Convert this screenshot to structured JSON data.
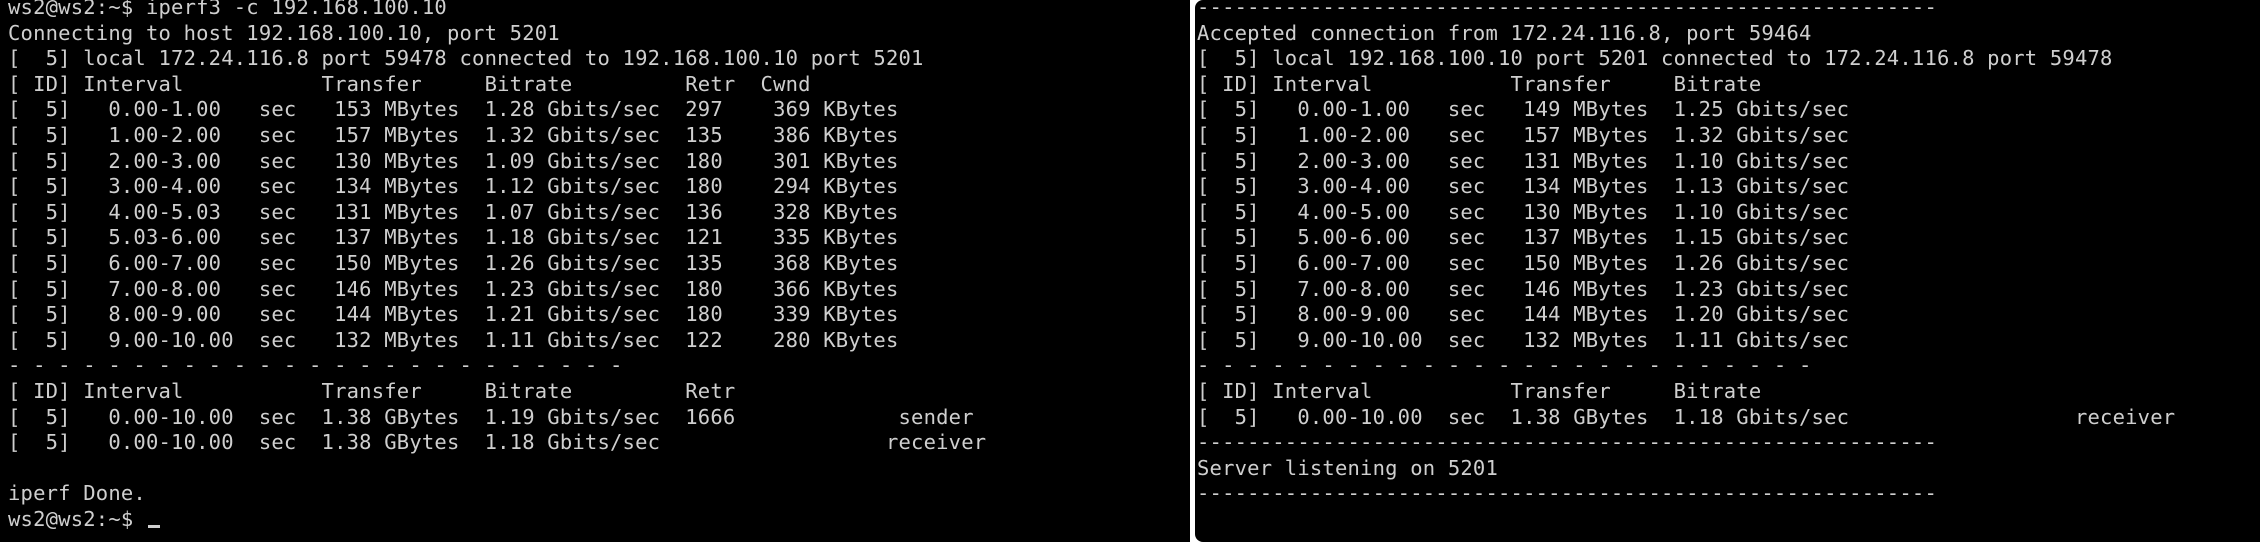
{
  "left_terminal": {
    "lines": [
      "ws2@ws2:~$ iperf3 -c 192.168.100.10",
      "Connecting to host 192.168.100.10, port 5201",
      "[  5] local 172.24.116.8 port 59478 connected to 192.168.100.10 port 5201",
      "[ ID] Interval           Transfer     Bitrate         Retr  Cwnd",
      "[  5]   0.00-1.00   sec   153 MBytes  1.28 Gbits/sec  297    369 KBytes",
      "[  5]   1.00-2.00   sec   157 MBytes  1.32 Gbits/sec  135    386 KBytes",
      "[  5]   2.00-3.00   sec   130 MBytes  1.09 Gbits/sec  180    301 KBytes",
      "[  5]   3.00-4.00   sec   134 MBytes  1.12 Gbits/sec  180    294 KBytes",
      "[  5]   4.00-5.03   sec   131 MBytes  1.07 Gbits/sec  136    328 KBytes",
      "[  5]   5.03-6.00   sec   137 MBytes  1.18 Gbits/sec  121    335 KBytes",
      "[  5]   6.00-7.00   sec   150 MBytes  1.26 Gbits/sec  135    368 KBytes",
      "[  5]   7.00-8.00   sec   146 MBytes  1.23 Gbits/sec  180    366 KBytes",
      "[  5]   8.00-9.00   sec   144 MBytes  1.21 Gbits/sec  180    339 KBytes",
      "[  5]   9.00-10.00  sec   132 MBytes  1.11 Gbits/sec  122    280 KBytes",
      "- - - - - - - - - - - - - - - - - - - - - - - - -",
      "[ ID] Interval           Transfer     Bitrate         Retr",
      "[  5]   0.00-10.00  sec  1.38 GBytes  1.19 Gbits/sec  1666             sender",
      "[  5]   0.00-10.00  sec  1.38 GBytes  1.18 Gbits/sec                  receiver",
      "",
      "iperf Done.",
      "ws2@ws2:~$ "
    ]
  },
  "right_terminal": {
    "lines": [
      "-----------------------------------------------------------",
      "Accepted connection from 172.24.116.8, port 59464",
      "[  5] local 192.168.100.10 port 5201 connected to 172.24.116.8 port 59478",
      "[ ID] Interval           Transfer     Bitrate",
      "[  5]   0.00-1.00   sec   149 MBytes  1.25 Gbits/sec",
      "[  5]   1.00-2.00   sec   157 MBytes  1.32 Gbits/sec",
      "[  5]   2.00-3.00   sec   131 MBytes  1.10 Gbits/sec",
      "[  5]   3.00-4.00   sec   134 MBytes  1.13 Gbits/sec",
      "[  5]   4.00-5.00   sec   130 MBytes  1.10 Gbits/sec",
      "[  5]   5.00-6.00   sec   137 MBytes  1.15 Gbits/sec",
      "[  5]   6.00-7.00   sec   150 MBytes  1.26 Gbits/sec",
      "[  5]   7.00-8.00   sec   146 MBytes  1.23 Gbits/sec",
      "[  5]   8.00-9.00   sec   144 MBytes  1.20 Gbits/sec",
      "[  5]   9.00-10.00  sec   132 MBytes  1.11 Gbits/sec",
      "- - - - - - - - - - - - - - - - - - - - - - - - -",
      "[ ID] Interval           Transfer     Bitrate",
      "[  5]   0.00-10.00  sec  1.38 GBytes  1.18 Gbits/sec                  receiver",
      "-----------------------------------------------------------",
      "Server listening on 5201",
      "-----------------------------------------------------------"
    ]
  },
  "colors": {
    "terminal_bg": "#000000",
    "terminal_text": "#cfcfcf"
  }
}
